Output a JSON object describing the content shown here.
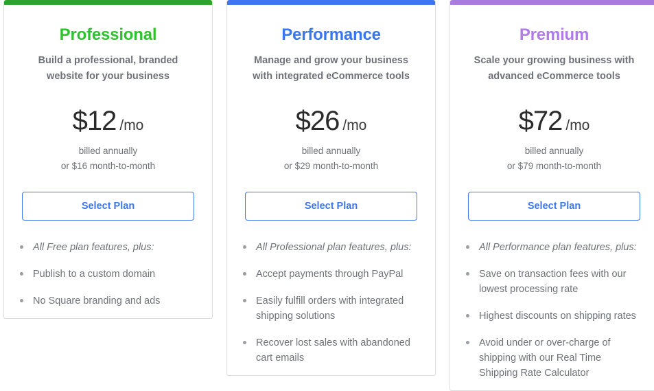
{
  "page": {
    "background": "#ffffff",
    "button_accent": "#3d76f0",
    "muted_text": "#6e7278",
    "price_text": "#2b2b2b",
    "bullet_color": "#9a9da2",
    "card_border": "#dcdcdc"
  },
  "plans": [
    {
      "name": "Professional",
      "accent_bar_color": "#2aa52a",
      "title_color": "#2fc22f",
      "subtitle": "Build a professional, branded website for your business",
      "price_amount": "$12",
      "price_period": "/mo",
      "billing_line_1": "billed annually",
      "billing_line_2": "or $16 month-to-month",
      "cta_label": "Select Plan",
      "features": [
        {
          "text": "All Free plan features, plus:",
          "italic": true
        },
        {
          "text": "Publish to a custom domain",
          "italic": false
        },
        {
          "text": "No Square branding and ads",
          "italic": false
        }
      ]
    },
    {
      "name": "Performance",
      "accent_bar_color": "#3a76ef",
      "title_color": "#3a76ef",
      "subtitle": "Manage and grow your business with integrated eCommerce tools",
      "price_amount": "$26",
      "price_period": "/mo",
      "billing_line_1": "billed annually",
      "billing_line_2": "or $29 month-to-month",
      "cta_label": "Select Plan",
      "features": [
        {
          "text": "All Professional plan features, plus:",
          "italic": true
        },
        {
          "text": "Accept payments through PayPal",
          "italic": false
        },
        {
          "text": "Easily fulfill orders with integrated shipping solutions",
          "italic": false
        },
        {
          "text": "Recover lost sales with abandoned cart emails",
          "italic": false
        }
      ]
    },
    {
      "name": "Premium",
      "accent_bar_color": "#ab7ae0",
      "title_color": "#b07ce8",
      "subtitle": "Scale your growing business with advanced eCommerce tools",
      "price_amount": "$72",
      "price_period": "/mo",
      "billing_line_1": "billed annually",
      "billing_line_2": "or $79 month-to-month",
      "cta_label": "Select Plan",
      "features": [
        {
          "text": "All Performance plan features, plus:",
          "italic": true
        },
        {
          "text": "Save on transaction fees with our lowest processing rate",
          "italic": false
        },
        {
          "text": "Highest discounts on shipping rates",
          "italic": false
        },
        {
          "text": "Avoid under or over-charge of shipping with our Real Time Shipping Rate Calculator",
          "italic": false
        }
      ]
    }
  ]
}
